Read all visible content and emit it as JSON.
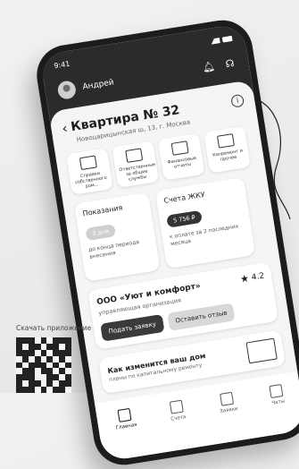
{
  "status": {
    "time": "9:41"
  },
  "header": {
    "user_name": "Андрей",
    "notifications_icon": "bell-icon",
    "support_icon": "headset-icon"
  },
  "apartment": {
    "title": "Квартира № 32",
    "address": "Новоцарицынская ш, 13, г. Москва"
  },
  "services": [
    {
      "icon": "document-icon",
      "label": "Справки собственного дом..."
    },
    {
      "icon": "calendar-icon",
      "label": "Ответственные за общие службы"
    },
    {
      "icon": "wallet-icon",
      "label": "Финансовые отчеты"
    },
    {
      "icon": "building-icon",
      "label": "Капремонт и прочее"
    }
  ],
  "meters": {
    "title": "Показания",
    "pill": "3 дня",
    "note": "до конца периода внесения"
  },
  "bill": {
    "title": "Счета ЖКУ",
    "amount": "5 756 ₽",
    "note": "к оплате за 2 последних месяца"
  },
  "org": {
    "name": "ООО «Уют и комфорт»",
    "subtitle": "управляющая организация",
    "rating": "4.2",
    "apply_label": "Подать заявку",
    "review_label": "Оставить отзыв"
  },
  "promo": {
    "title": "Как изменится ваш дом",
    "subtitle": "планы по капитальному ремонту"
  },
  "tabs": [
    {
      "label": "Главная",
      "icon": "home-icon",
      "active": true
    },
    {
      "label": "Счета",
      "icon": "receipt-icon"
    },
    {
      "label": "Заявки",
      "icon": "pencil-icon"
    },
    {
      "label": "Чаты",
      "icon": "chat-icon"
    }
  ],
  "download": {
    "label": "Скачать приложение"
  },
  "colors": {
    "dark": "#2b2b2b",
    "background": "#ebebeb",
    "card": "#ffffff"
  }
}
